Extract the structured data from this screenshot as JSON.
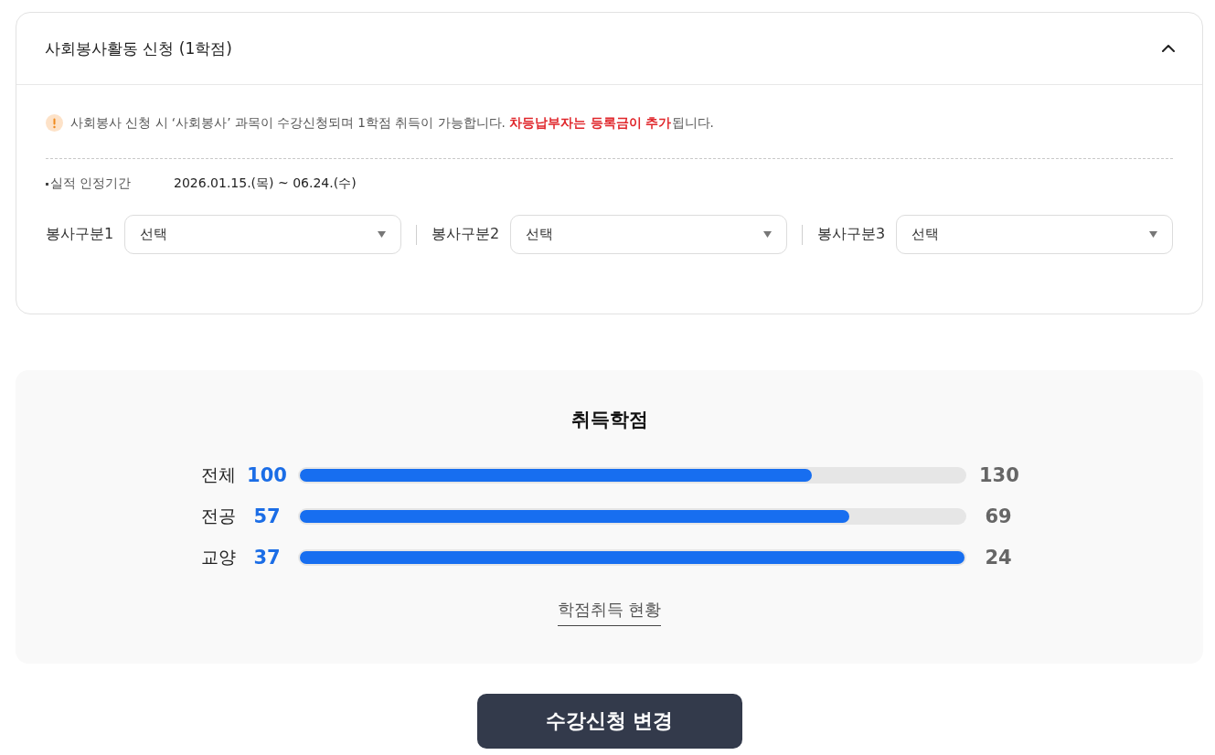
{
  "panel": {
    "title": "사회봉사활동 신청 (1학점)",
    "expanded": true,
    "notice": "사회봉사 신청 시 ‘사회봉사’ 과목이 수강신청되며 1학점 취득이 가능합니다. **차등납부자는 등록금이 추가**됩니다.",
    "period": {
      "label": "실적 인정기간",
      "value": "2026.01.15.(목) ~ 06.24.(수)"
    },
    "selects": [
      {
        "label": "봉사구분1",
        "value": "선택"
      },
      {
        "label": "봉사구분2",
        "value": "선택"
      },
      {
        "label": "봉사구분3",
        "value": "선택"
      }
    ]
  },
  "credits": {
    "title": "취득학점",
    "rows": [
      {
        "label": "전체",
        "earned": "100",
        "required": "130",
        "level": 0.77
      },
      {
        "label": "전공",
        "earned": "57",
        "required": "69",
        "level": 0.826
      },
      {
        "label": "교양",
        "earned": "37",
        "required": "24",
        "level": 1
      }
    ],
    "link": "학점취득 현황"
  },
  "button": "수강신청 변경"
}
